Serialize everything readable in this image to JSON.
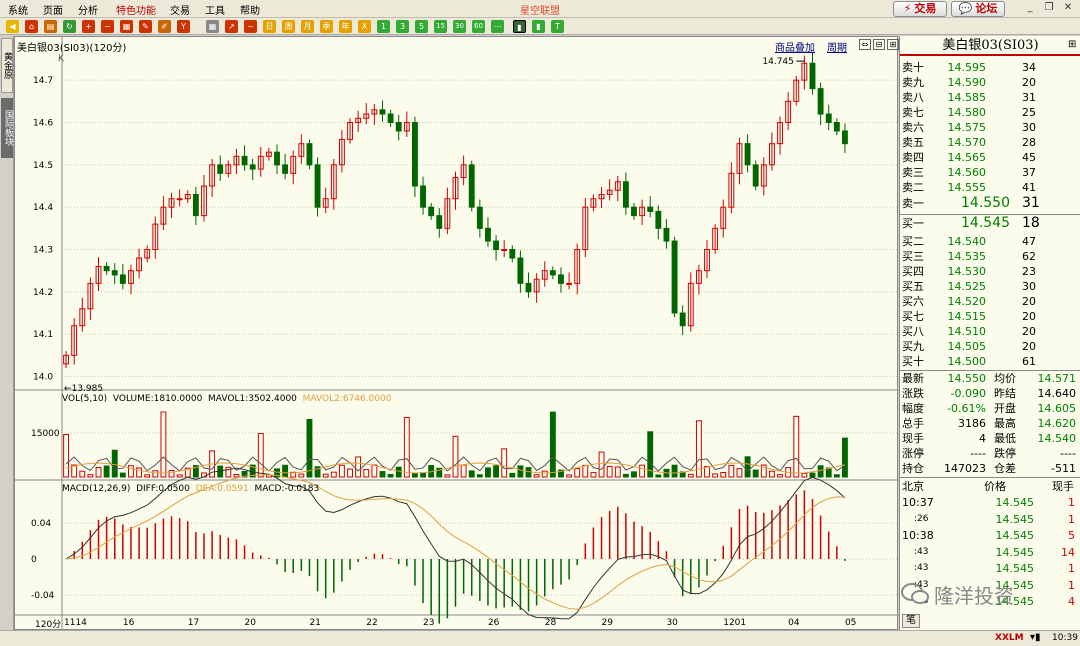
{
  "menu": {
    "items": [
      "系统",
      "页面",
      "分析",
      "特色功能",
      "交易",
      "工具",
      "帮助"
    ],
    "title": "星空联盟",
    "trade_button": "交易",
    "forum_button": "论坛"
  },
  "toolbar": {
    "period_buttons": [
      "1",
      "3",
      "5",
      "15",
      "30",
      "60"
    ]
  },
  "side_tabs": {
    "tab1": "黄金原",
    "tab2": "国际板块"
  },
  "chart": {
    "header": "美白银03(SI03)(120分)",
    "link_overlay": "商品叠加",
    "link_period": "周期",
    "k_label": "K",
    "vol_label": "VOL(5,10)",
    "vol_text": "VOLUME:1810.0000",
    "mavol1_text": "MAVOL1:3502.4000",
    "mavol2_text": "MAVOL2:6746.0000",
    "macd_label": "MACD(12,26,9)",
    "diff_text": "DIFF:0.0500",
    "dea_text": "DEA:0.0591",
    "macd_text": "MACD:-0.0183",
    "period_label": "120分",
    "high_marker": "14.745",
    "low_marker": "13.985",
    "colors": {
      "up": "#d00000",
      "down": "#006600",
      "background": "#fcfcec",
      "grid": "#c8c8b8",
      "mavol1": "#555555",
      "mavol2": "#e0a040"
    }
  },
  "chart_data": [
    {
      "type": "candlestick",
      "title": "美白银03(SI03)(120分)",
      "ylim": [
        13.98,
        14.75
      ],
      "yticks": [
        "14.7",
        "14.6",
        "14.5",
        "14.4",
        "14.3",
        "14.2",
        "14.1",
        "14.0"
      ],
      "xticks": [
        "1114",
        "16",
        "17",
        "20",
        "21",
        "22",
        "23",
        "26",
        "28",
        "29",
        "30",
        "1201",
        "04",
        "05"
      ],
      "close_series": [
        14.05,
        14.12,
        14.16,
        14.22,
        14.26,
        14.25,
        14.24,
        14.22,
        14.25,
        14.28,
        14.3,
        14.36,
        14.4,
        14.42,
        14.42,
        14.43,
        14.38,
        14.45,
        14.5,
        14.48,
        14.5,
        14.52,
        14.5,
        14.49,
        14.52,
        14.53,
        14.5,
        14.48,
        14.52,
        14.55,
        14.5,
        14.4,
        14.42,
        14.5,
        14.56,
        14.6,
        14.61,
        14.62,
        14.63,
        14.62,
        14.6,
        14.58,
        14.6,
        14.45,
        14.4,
        14.38,
        14.35,
        14.42,
        14.47,
        14.5,
        14.4,
        14.35,
        14.32,
        14.3,
        14.3,
        14.28,
        14.22,
        14.2,
        14.23,
        14.25,
        14.24,
        14.22,
        14.22,
        14.3,
        14.4,
        14.42,
        14.43,
        14.44,
        14.46,
        14.4,
        14.38,
        14.4,
        14.39,
        14.35,
        14.32,
        14.15,
        14.12,
        14.22,
        14.25,
        14.3,
        14.35,
        14.4,
        14.48,
        14.55,
        14.5,
        14.45,
        14.5,
        14.55,
        14.6,
        14.65,
        14.7,
        14.74,
        14.68,
        14.62,
        14.6,
        14.58,
        14.55
      ],
      "volume_ylabel": "15000",
      "macd_yticks": [
        "0.04",
        "0",
        "-0.04"
      ]
    }
  ],
  "quote": {
    "title": "美白银03(SI03)",
    "asks": [
      {
        "label": "卖十",
        "price": "14.595",
        "vol": "34"
      },
      {
        "label": "卖九",
        "price": "14.590",
        "vol": "20"
      },
      {
        "label": "卖八",
        "price": "14.585",
        "vol": "31"
      },
      {
        "label": "卖七",
        "price": "14.580",
        "vol": "25"
      },
      {
        "label": "卖六",
        "price": "14.575",
        "vol": "30"
      },
      {
        "label": "卖五",
        "price": "14.570",
        "vol": "28"
      },
      {
        "label": "卖四",
        "price": "14.565",
        "vol": "45"
      },
      {
        "label": "卖三",
        "price": "14.560",
        "vol": "37"
      },
      {
        "label": "卖二",
        "price": "14.555",
        "vol": "41"
      },
      {
        "label": "卖一",
        "price": "14.550",
        "vol": "31"
      }
    ],
    "bids": [
      {
        "label": "买一",
        "price": "14.545",
        "vol": "18"
      },
      {
        "label": "买二",
        "price": "14.540",
        "vol": "47"
      },
      {
        "label": "买三",
        "price": "14.535",
        "vol": "62"
      },
      {
        "label": "买四",
        "price": "14.530",
        "vol": "23"
      },
      {
        "label": "买五",
        "price": "14.525",
        "vol": "30"
      },
      {
        "label": "买六",
        "price": "14.520",
        "vol": "20"
      },
      {
        "label": "买七",
        "price": "14.515",
        "vol": "20"
      },
      {
        "label": "买八",
        "price": "14.510",
        "vol": "20"
      },
      {
        "label": "买九",
        "price": "14.505",
        "vol": "20"
      },
      {
        "label": "买十",
        "price": "14.500",
        "vol": "61"
      }
    ],
    "stats": [
      {
        "l1": "最新",
        "v1": "14.550",
        "l2": "均价",
        "v2": "14.571"
      },
      {
        "l1": "涨跌",
        "v1": "-0.090",
        "l2": "昨结",
        "v2": "14.640"
      },
      {
        "l1": "幅度",
        "v1": "-0.61%",
        "l2": "开盘",
        "v2": "14.605"
      },
      {
        "l1": "总手",
        "v1": "3186",
        "l2": "最高",
        "v2": "14.620"
      },
      {
        "l1": "现手",
        "v1": "4",
        "l2": "最低",
        "v2": "14.540"
      },
      {
        "l1": "涨停",
        "v1": "----",
        "l2": "跌停",
        "v2": "----"
      },
      {
        "l1": "持仓",
        "v1": "147023",
        "l2": "仓差",
        "v2": "-511"
      }
    ],
    "ticks_header": {
      "c1": "北京",
      "c2": "价格",
      "c3": "现手"
    },
    "ticks": [
      {
        "time": "10:37",
        "price": "14.545",
        "qty": "1"
      },
      {
        "time": ":26",
        "price": "14.545",
        "qty": "1"
      },
      {
        "time": "10:38",
        "price": "14.545",
        "qty": "5"
      },
      {
        "time": ":43",
        "price": "14.545",
        "qty": "14"
      },
      {
        "time": ":43",
        "price": "14.545",
        "qty": "1"
      },
      {
        "time": ":43",
        "price": "14.545",
        "qty": "1"
      },
      {
        "time": ":43",
        "price": "14.545",
        "qty": "4"
      }
    ],
    "bottom_tab": "笔"
  },
  "status": {
    "brand": "XXLM",
    "clock": "10:39"
  },
  "watermark": {
    "text": "隆洋投资"
  }
}
